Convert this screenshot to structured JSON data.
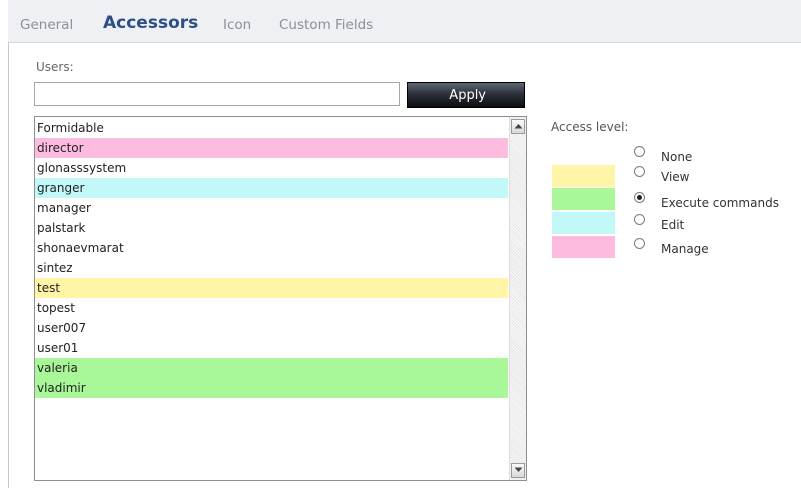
{
  "tabs": [
    {
      "label": "General",
      "active": false
    },
    {
      "label": "Accessors",
      "active": true
    },
    {
      "label": "Icon",
      "active": false
    },
    {
      "label": "Custom Fields",
      "active": false
    }
  ],
  "users": {
    "label": "Users:",
    "input_value": "",
    "apply_label": "Apply"
  },
  "users_list": [
    {
      "name": "Formidable",
      "level": "none"
    },
    {
      "name": "director",
      "level": "manage"
    },
    {
      "name": "glonasssystem",
      "level": "none"
    },
    {
      "name": "granger",
      "level": "edit"
    },
    {
      "name": "manager",
      "level": "none"
    },
    {
      "name": "palstark",
      "level": "none"
    },
    {
      "name": "shonaevmarat",
      "level": "none"
    },
    {
      "name": "sintez",
      "level": "none"
    },
    {
      "name": "test",
      "level": "view"
    },
    {
      "name": "topest",
      "level": "none"
    },
    {
      "name": "user007",
      "level": "none"
    },
    {
      "name": "user01",
      "level": "none"
    },
    {
      "name": "valeria",
      "level": "execute"
    },
    {
      "name": "vladimir",
      "level": "execute"
    }
  ],
  "access": {
    "label": "Access level:",
    "levels": [
      {
        "key": "none",
        "label": "None",
        "color": "",
        "selected": false
      },
      {
        "key": "view",
        "label": "View",
        "color": "#fff5a6",
        "selected": false
      },
      {
        "key": "execute",
        "label": "Execute commands",
        "color": "#aaf799",
        "selected": true
      },
      {
        "key": "edit",
        "label": "Edit",
        "color": "#c3f8f9",
        "selected": false
      },
      {
        "key": "manage",
        "label": "Manage",
        "color": "#fdbcdf",
        "selected": false
      }
    ]
  },
  "icons": {
    "scroll_up": "scroll-up-arrow-icon",
    "scroll_down": "scroll-down-arrow-icon"
  }
}
